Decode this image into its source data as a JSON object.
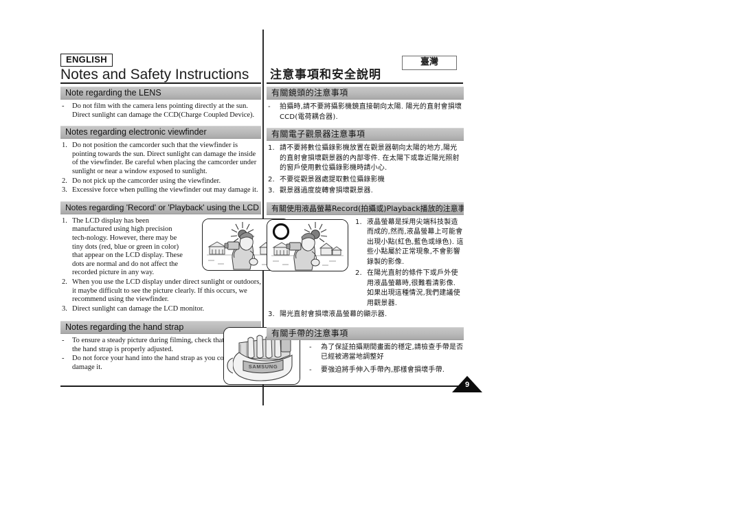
{
  "header": {
    "language_chip": "ENGLISH",
    "region_chip": "臺灣",
    "title_en": "Notes and Safety Instructions",
    "title_zh": "注意事項和安全說明"
  },
  "page_number": "9",
  "sections_en": [
    {
      "id": "lens",
      "heading": "Note regarding the LENS",
      "items": [
        {
          "marker": "-",
          "text": "Do not film with the camera lens pointing directly at the sun. Direct sunlight can damage the CCD(Charge Coupled Device)."
        }
      ]
    },
    {
      "id": "viewfinder",
      "heading": "Notes regarding electronic viewfinder",
      "items": [
        {
          "marker": "1.",
          "text": "Do not position the camcorder such that the viewfinder is pointing towards the sun. Direct sunlight can damage the inside of the viewfinder. Be careful when placing the camcorder under sunlight or near a window exposed to sunlight."
        },
        {
          "marker": "2.",
          "text": "Do not pick up the camcorder using the viewfinder."
        },
        {
          "marker": "3.",
          "text": "Excessive force when pulling the viewfinder out may damage it."
        }
      ]
    },
    {
      "id": "lcd",
      "heading": "Notes regarding 'Record' or 'Playback' using the LCD",
      "items": [
        {
          "marker": "1.",
          "text": "The LCD display has been manufactured using high precision tech-nology. However, there may be tiny dots (red, blue or green in color) that appear on the LCD display. These dots are normal and do not affect the recorded picture in any way."
        },
        {
          "marker": "2.",
          "text": "When you use the LCD display under direct sunlight or outdoors, it maybe difficult to see the picture clearly. If this occurs, we recommend using the viewfinder."
        },
        {
          "marker": "3.",
          "text": "Direct sunlight can damage the LCD monitor."
        }
      ]
    },
    {
      "id": "handstrap",
      "heading": "Notes regarding the hand strap",
      "items": [
        {
          "marker": "-",
          "text": "To ensure a steady picture during filming, check that the hand strap is properly adjusted."
        },
        {
          "marker": "-",
          "text": "Do not force your hand into the hand strap as you could damage it."
        }
      ]
    }
  ],
  "sections_zh": [
    {
      "id": "lens",
      "heading": "有關鏡頭的注意事項",
      "items": [
        {
          "marker": "-",
          "text": "拍攝時,請不要將攝影機鏡直接朝向太陽. 陽光的直射會損壞CCD(電荷耦合器)."
        }
      ]
    },
    {
      "id": "viewfinder",
      "heading": "有關電子觀景器注意事項",
      "items": [
        {
          "marker": "1.",
          "text": "請不要將數位攝錄影機放置在觀景器朝向太陽的地方,陽光的直射會損壞觀景器的內部零件. 在太陽下或靠近陽光照射的窗戶使用數位攝錄影機時請小心."
        },
        {
          "marker": "2.",
          "text": "不要從觀景器處提取數位攝錄影機"
        },
        {
          "marker": "3.",
          "text": "觀景器過度旋轉會損壞觀景器."
        }
      ]
    },
    {
      "id": "lcd",
      "heading": "有關使用液晶螢幕Record(拍攝或)Playback播放的注意事項",
      "items": [
        {
          "marker": "1.",
          "text": "液晶螢幕是採用尖端科技製造而成的,然而,液晶螢幕上可能會出現小點(紅色,藍色或綠色). 這些小點屬於正常現象,不會影響錄製的影像."
        },
        {
          "marker": "2.",
          "text": "在陽光直射的條件下或戶外使用液晶螢幕時,很難看清影像. 如果出現這種情況,我們建議使用觀景器."
        },
        {
          "marker": "3.",
          "text": "陽光直射會損壞液晶螢幕的顯示器."
        }
      ]
    },
    {
      "id": "handstrap",
      "heading": "有關手帶的注意事項",
      "items": [
        {
          "marker": "-",
          "text": "為了保証拍攝期間畫面的穩定,請檢查手帶是否已經被適當地調整好"
        },
        {
          "marker": "-",
          "text": "要強迫將手伸入手帶內,那樣會損壞手帶."
        }
      ]
    }
  ],
  "figures": {
    "lcd_bad": {
      "name": "person-filming-toward-sun-forbidden",
      "overlay": "cross-mark",
      "brand": ""
    },
    "lcd_good": {
      "name": "person-filming-away-from-sun-allowed",
      "overlay": "circle-mark",
      "brand": ""
    },
    "hand_strap": {
      "name": "hand-gripping-camcorder-strap",
      "brand": "SAMSUNG"
    }
  },
  "colors": {
    "ink": "#141414",
    "bar_gray": "#b9b9b9",
    "rule": "#1b1b1b",
    "figure_shade": "#d9d9d9"
  }
}
